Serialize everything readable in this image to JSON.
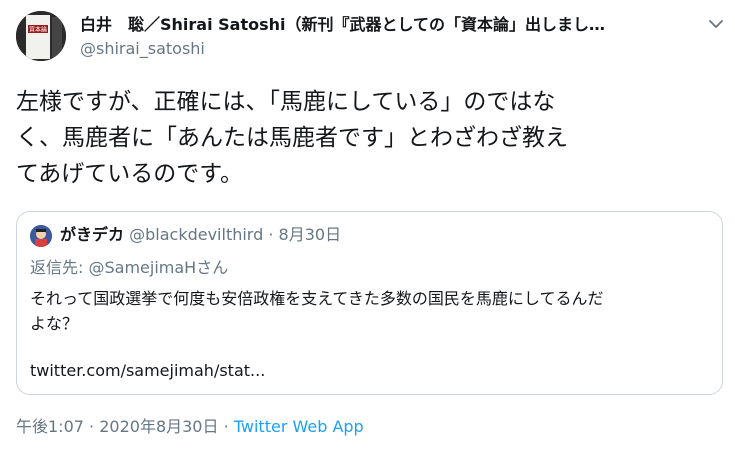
{
  "author": {
    "name": "白井　聡／Shirai Satoshi（新刊『武器としての「資本論」出しまし…",
    "handle": "@shirai_satoshi",
    "avatar_cover_text": "資本論"
  },
  "tweet": {
    "lines": [
      "左様ですが、正確には、「馬鹿にしている」のではな",
      "く、馬鹿者に「あんたは馬鹿者です」とわざわざ教え",
      "てあげているのです。"
    ]
  },
  "quoted": {
    "name": "がきデカ",
    "handle": "@blackdevilthird",
    "separator": "·",
    "date": "8月30日",
    "reply_prefix": "返信先:",
    "reply_mention": "@SamejimaHさん",
    "body_lines": [
      "それって国政選挙で何度も安倍政権を支えてきた多数の国民を馬鹿にしてるんだ",
      "よな？"
    ],
    "link": "twitter.com/samejimah/stat..."
  },
  "footer": {
    "time": "午後1:07",
    "sep1": "·",
    "date": "2020年8月30日",
    "sep2": "·",
    "app": "Twitter Web App"
  },
  "colors": {
    "text": "#14171a",
    "muted": "#657786",
    "link": "#1da1f2",
    "border": "#ccd6dd"
  }
}
